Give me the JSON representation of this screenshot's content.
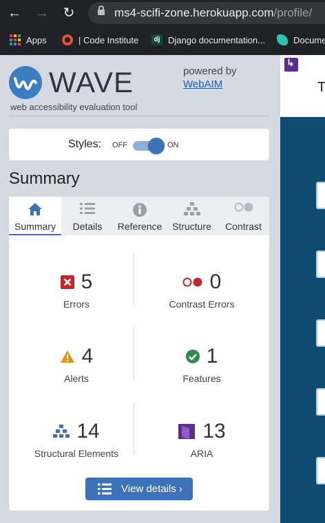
{
  "browser": {
    "url_host": "ms4-scifi-zone.herokuapp.com",
    "url_path": "/profile/",
    "bookmarks": [
      {
        "label": "Apps",
        "icon": "apps-grid-icon"
      },
      {
        "label": "| Code Institute",
        "icon": "code-institute-icon"
      },
      {
        "label": "Django documentation...",
        "icon": "django-icon"
      },
      {
        "label": "Docume",
        "icon": "documentation-icon"
      }
    ]
  },
  "wave": {
    "logo_text": "WAVE",
    "tagline": "web accessibility evaluation tool",
    "powered_by": "powered by",
    "webaim_link": "WebAIM",
    "styles_label": "Styles:",
    "toggle_off": "OFF",
    "toggle_on": "ON",
    "styles_on": true,
    "summary_heading": "Summary",
    "tabs": [
      {
        "label": "Summary",
        "icon": "home-icon",
        "active": true
      },
      {
        "label": "Details",
        "icon": "list-icon",
        "active": false
      },
      {
        "label": "Reference",
        "icon": "info-icon",
        "active": false
      },
      {
        "label": "Structure",
        "icon": "hierarchy-icon",
        "active": false
      },
      {
        "label": "Contrast",
        "icon": "contrast-icon",
        "active": false
      }
    ],
    "stats": [
      {
        "count": "5",
        "label": "Errors",
        "icon": "error-icon",
        "color": "#c4262e"
      },
      {
        "count": "0",
        "label": "Contrast Errors",
        "icon": "contrast-error-icon",
        "color": "#c4262e"
      },
      {
        "count": "4",
        "label": "Alerts",
        "icon": "alert-icon",
        "color": "#e3921c"
      },
      {
        "count": "1",
        "label": "Features",
        "icon": "feature-icon",
        "color": "#2f8a4e"
      },
      {
        "count": "14",
        "label": "Structural Elements",
        "icon": "structure-icon",
        "color": "#3c73b8"
      },
      {
        "count": "13",
        "label": "ARIA",
        "icon": "aria-icon",
        "color": "#5c2d91"
      }
    ],
    "view_details_label": "View details ›"
  },
  "site_preview": {
    "visible_letter": "T"
  },
  "colors": {
    "accent": "#3c73b8",
    "site_background": "#0f4a70"
  }
}
